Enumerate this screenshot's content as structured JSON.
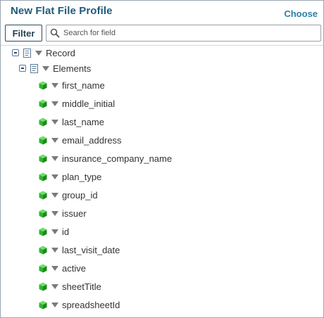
{
  "header": {
    "title": "New Flat File Profile",
    "choose_label": "Choose"
  },
  "toolbar": {
    "filter_label": "Filter",
    "search_placeholder": "Search for field",
    "search_value": ""
  },
  "tree": {
    "root_label": "Record",
    "group_label": "Elements",
    "fields": [
      {
        "label": "first_name"
      },
      {
        "label": "middle_initial"
      },
      {
        "label": "last_name"
      },
      {
        "label": "email_address"
      },
      {
        "label": "insurance_company_name"
      },
      {
        "label": "plan_type"
      },
      {
        "label": "group_id"
      },
      {
        "label": "issuer"
      },
      {
        "label": "id"
      },
      {
        "label": "last_visit_date"
      },
      {
        "label": "active"
      },
      {
        "label": "sheetTitle"
      },
      {
        "label": "spreadsheetId"
      }
    ]
  },
  "icons": {
    "field_icon": "green-cube-icon",
    "node_icon": "document-icon",
    "expand_icon": "collapse-toggle-icon",
    "menu_icon": "caret-down-icon",
    "search_icon": "magnifier-icon"
  },
  "colors": {
    "title": "#1f5b78",
    "accent": "#2c7fa8",
    "field_icon": "#2fb52f"
  }
}
